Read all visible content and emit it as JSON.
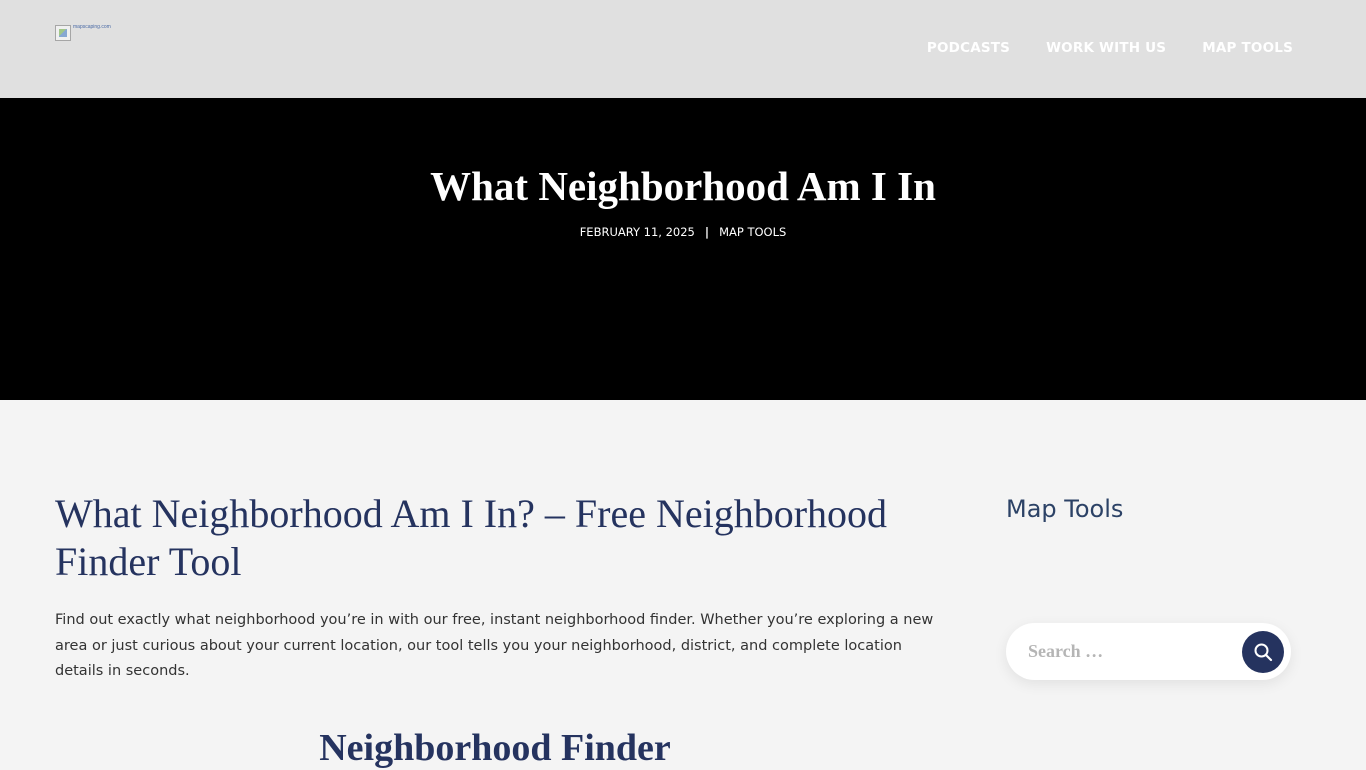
{
  "header": {
    "logo_alt": "mapscaping.com",
    "nav": [
      {
        "label": "PODCASTS"
      },
      {
        "label": "WORK WITH US"
      },
      {
        "label": "MAP TOOLS"
      }
    ]
  },
  "hero": {
    "title": "What Neighborhood Am I In",
    "date": "FEBRUARY 11, 2025",
    "separator": "|",
    "category": "MAP TOOLS"
  },
  "content": {
    "post_title": "What Neighborhood Am I In? – Free Neighborhood Finder Tool",
    "intro": "Find out exactly what neighborhood you’re in with our free, instant neighborhood finder. Whether you’re exploring a new area or just curious about your current location, our tool tells you your neighborhood, district, and complete location details in seconds.",
    "tool_heading": "Neighborhood Finder"
  },
  "sidebar": {
    "widget_title": "Map Tools",
    "search_placeholder": "Search …",
    "search_icon": "search-icon"
  },
  "colors": {
    "header_bg": "#e0e0e0",
    "hero_bg": "#000000",
    "page_bg": "#f4f4f4",
    "accent_navy": "#25335f",
    "widget_title": "#2c4266"
  }
}
